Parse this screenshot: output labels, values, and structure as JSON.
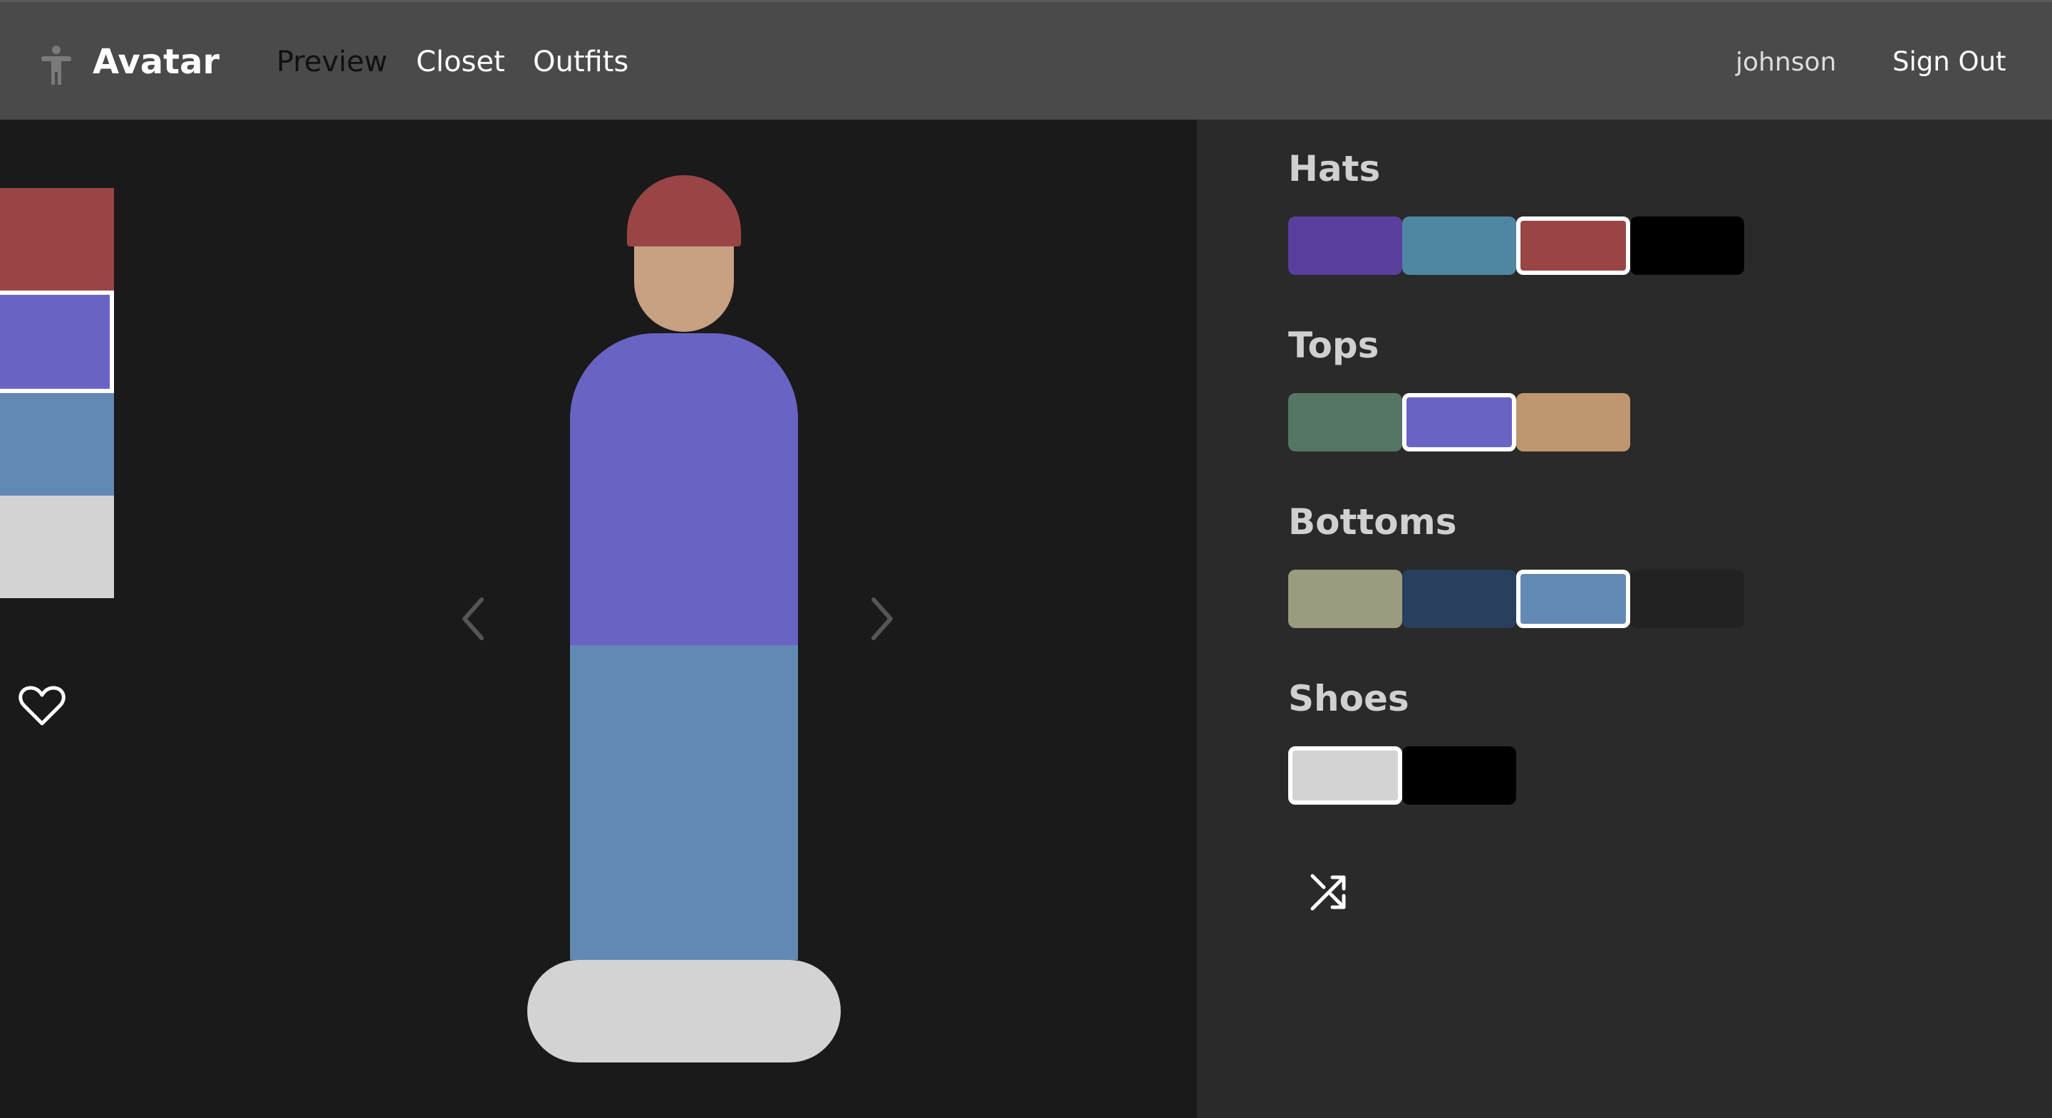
{
  "header": {
    "brand": "Avatar",
    "brand_icon": "accessibility-figure-icon",
    "nav": [
      {
        "label": "Preview",
        "active": true
      },
      {
        "label": "Closet",
        "active": false
      },
      {
        "label": "Outfits",
        "active": false
      }
    ],
    "username": "johnson",
    "signout_label": "Sign Out"
  },
  "preview": {
    "color_strip": [
      {
        "color": "#9a4545",
        "selected": false
      },
      {
        "color": "#6964c4",
        "selected": true
      },
      {
        "color": "#6289b4",
        "selected": false
      },
      {
        "color": "#d3d3d3",
        "selected": false
      }
    ],
    "favorite_icon": "heart-outline-icon",
    "prev_icon": "chevron-left-icon",
    "next_icon": "chevron-right-icon",
    "avatar": {
      "hat_color": "#9a4545",
      "skin_color": "#c8a082",
      "top_color": "#6964c4",
      "bottom_color": "#6289b4",
      "shoes_color": "#d3d3d3"
    }
  },
  "closet": {
    "categories": [
      {
        "title": "Hats",
        "swatches": [
          {
            "color": "#5b3f9e",
            "selected": false
          },
          {
            "color": "#4f87a3",
            "selected": false
          },
          {
            "color": "#9a4545",
            "selected": true
          },
          {
            "color": "#000000",
            "selected": false
          }
        ]
      },
      {
        "title": "Tops",
        "swatches": [
          {
            "color": "#557665",
            "selected": false
          },
          {
            "color": "#6964c4",
            "selected": true
          },
          {
            "color": "#bf966f",
            "selected": false
          }
        ]
      },
      {
        "title": "Bottoms",
        "swatches": [
          {
            "color": "#9b9b80",
            "selected": false
          },
          {
            "color": "#293f5e",
            "selected": false
          },
          {
            "color": "#6289b4",
            "selected": true
          },
          {
            "color": "#222222",
            "selected": false
          }
        ]
      },
      {
        "title": "Shoes",
        "swatches": [
          {
            "color": "#d3d3d3",
            "selected": true
          },
          {
            "color": "#000000",
            "selected": false
          }
        ]
      }
    ],
    "shuffle_icon": "shuffle-icon"
  }
}
